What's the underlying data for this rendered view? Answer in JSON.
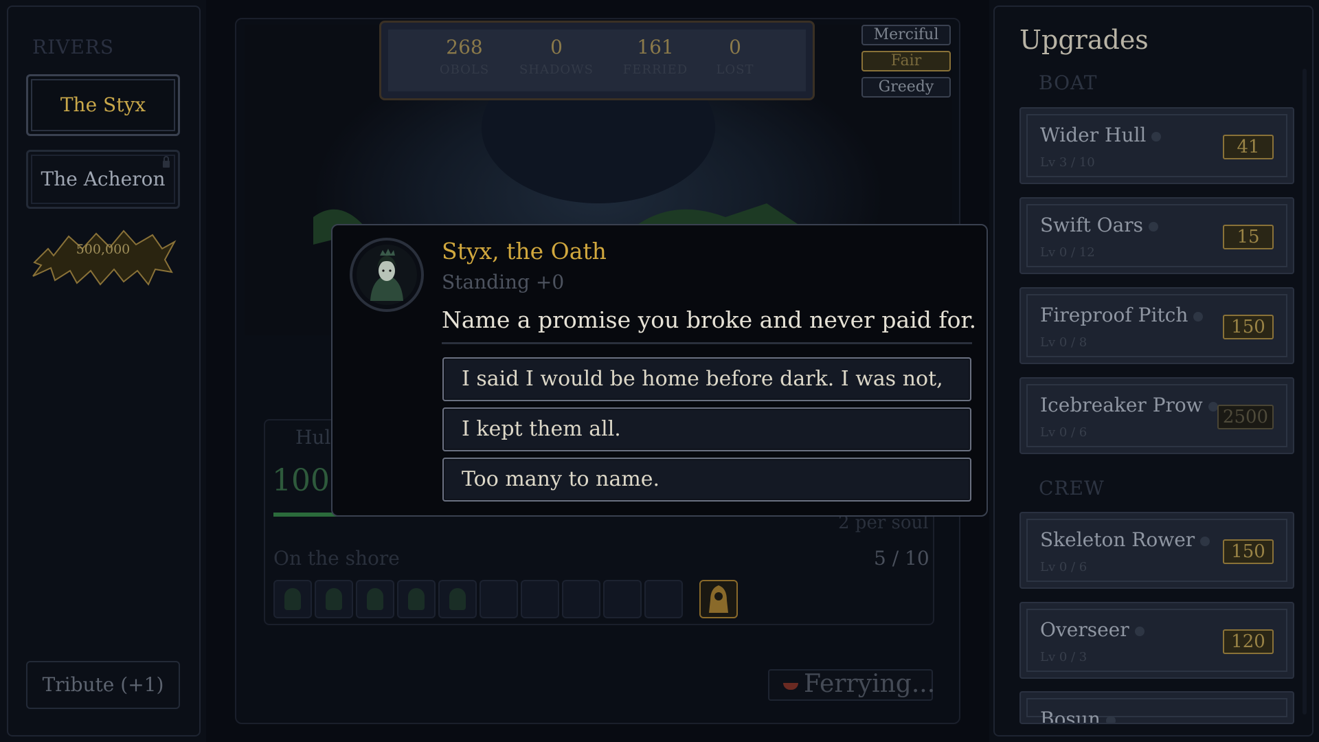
{
  "rivers": {
    "heading": "RIVERS",
    "items": [
      {
        "label": "The Styx"
      },
      {
        "label": "The Acheron"
      }
    ],
    "splash_value": "500,000",
    "tribute_label": "Tribute (+1)"
  },
  "stats": [
    {
      "value": "268",
      "label": "OBOLS"
    },
    {
      "value": "0",
      "label": "SHADOWS"
    },
    {
      "value": "161",
      "label": "FERRIED"
    },
    {
      "value": "0",
      "label": "LOST"
    }
  ],
  "modes": [
    {
      "label": "Merciful"
    },
    {
      "label": "Fair"
    },
    {
      "label": "Greedy"
    }
  ],
  "hull": {
    "label": "Hull",
    "value": "100",
    "fill_fraction": 0.2,
    "per_soul": "2 per soul"
  },
  "shore": {
    "label": "On the shore",
    "count": "5 / 10",
    "filled_slots": 5,
    "total_slots": 10
  },
  "ferry_label": "Ferrying...",
  "dialog": {
    "speaker": "Styx, the Oath",
    "standing": "Standing +0",
    "prompt": "Name a promise you broke and never paid for.",
    "choices": [
      "I said I would be home before dark. I was not, once.",
      "I kept them all.",
      "Too many to name."
    ]
  },
  "upgrades": {
    "title": "Upgrades",
    "sections": [
      {
        "heading": "BOAT",
        "items": [
          {
            "name": "Wider Hull",
            "level": "Lv 3 / 10",
            "cost": "41",
            "affordable": true
          },
          {
            "name": "Swift Oars",
            "level": "Lv 0 / 12",
            "cost": "15",
            "affordable": true
          },
          {
            "name": "Fireproof Pitch",
            "level": "Lv 0 / 8",
            "cost": "150",
            "affordable": true
          },
          {
            "name": "Icebreaker Prow",
            "level": "Lv 0 / 6",
            "cost": "2500",
            "affordable": false
          }
        ]
      },
      {
        "heading": "CREW",
        "items": [
          {
            "name": "Skeleton Rower",
            "level": "Lv 0 / 6",
            "cost": "150",
            "affordable": true
          },
          {
            "name": "Overseer",
            "level": "Lv 0 / 3",
            "cost": "120",
            "affordable": true
          },
          {
            "name": "Bosun",
            "level": "",
            "cost": "",
            "affordable": true
          }
        ]
      }
    ]
  },
  "colors": {
    "accent_gold": "#d1a83e",
    "hull_green": "#2b6b3b",
    "background": "#080b12"
  }
}
